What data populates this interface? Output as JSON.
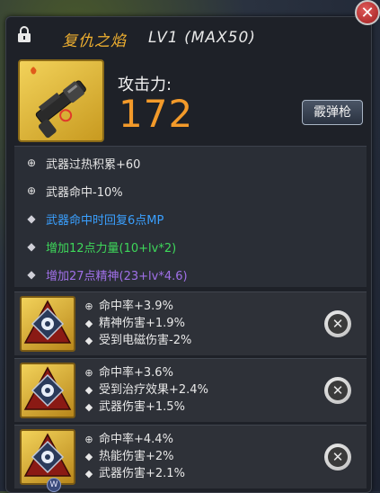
{
  "header": {
    "weapon_name": "复仇之焰",
    "level_text": "LV1 (MAX50)"
  },
  "attack": {
    "label": "攻击力:",
    "value": "172",
    "weapon_type": "霰弹枪"
  },
  "stats": [
    {
      "text": "武器过热积累+60",
      "color": "white",
      "icon": "target-icon"
    },
    {
      "text": "武器命中-10%",
      "color": "white",
      "icon": "target-icon"
    },
    {
      "text": "武器命中时回复6点MP",
      "color": "blue",
      "icon": "diamond-icon"
    },
    {
      "text": "增加12点力量(10+lv*2)",
      "color": "green",
      "icon": "diamond-icon"
    },
    {
      "text": "增加27点精神(23+lv*4.6)",
      "color": "purple",
      "icon": "diamond-icon"
    }
  ],
  "gems": [
    {
      "lines": [
        "命中率+3.9%",
        "精神伤害+1.9%",
        "受到电磁伤害-2%"
      ]
    },
    {
      "lines": [
        "命中率+3.6%",
        "受到治疗效果+2.4%",
        "武器伤害+1.5%"
      ]
    },
    {
      "lines": [
        "命中率+4.4%",
        "热能伤害+2%",
        "武器伤害+2.1%"
      ]
    }
  ],
  "badge": "W",
  "colors": {
    "name": "#f0b030",
    "attack_value": "#f39a2a",
    "blue": "#3aa0ff",
    "green": "#3ed85a",
    "purple": "#a070e8"
  }
}
